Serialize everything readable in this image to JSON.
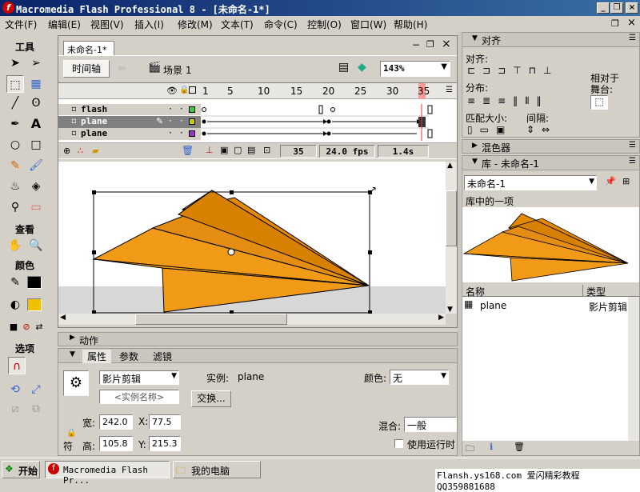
{
  "window": {
    "title": "Macromedia Flash Professional 8 - [未命名-1*]"
  },
  "menu": [
    "文件(F)",
    "编辑(E)",
    "视图(V)",
    "插入(I)",
    "修改(M)",
    "文本(T)",
    "命令(C)",
    "控制(O)",
    "窗口(W)",
    "帮助(H)"
  ],
  "toolbox": {
    "tools_label": "工具",
    "view_label": "查看",
    "colors_label": "颜色",
    "options_label": "选项"
  },
  "document": {
    "tab": "未命名-1*",
    "timeline_button": "时间轴",
    "scene": "场景 1",
    "zoom": "143%",
    "frame_numbers": [
      "1",
      "5",
      "10",
      "15",
      "20",
      "25",
      "30",
      "35"
    ],
    "layers": [
      {
        "name": "flash",
        "color": "#33cc33",
        "selected": false
      },
      {
        "name": "plane",
        "color": "#cccc00",
        "selected": true
      },
      {
        "name": "plane",
        "color": "#9933cc",
        "selected": false
      }
    ],
    "current_frame": "35",
    "fps": "24.0 fps",
    "time": "1.4s"
  },
  "actions_panel": {
    "title": "动作"
  },
  "properties_panel": {
    "tabs": [
      "属性",
      "参数",
      "滤镜"
    ],
    "symbol_type": "影片剪辑",
    "instance_label": "实例:",
    "instance_value": "plane",
    "instance_name_placeholder": "<实例名称>",
    "swap_button": "交换...",
    "color_label": "颜色:",
    "color_value": "无",
    "width_label": "宽:",
    "width_value": "242.0",
    "height_label": "高:",
    "height_value": "105.8",
    "x_label": "X:",
    "x_value": "77.5",
    "y_label": "Y:",
    "y_value": "215.3",
    "blend_label": "混合:",
    "blend_value": "一般",
    "runtime_cache_label": "使用运行时",
    "lock_label": "符"
  },
  "align_panel": {
    "title": "对齐",
    "align_label": "对齐:",
    "distribute_label": "分布:",
    "match_size_label": "匹配大小:",
    "spacing_label": "间隔:",
    "relative_label": "相对于",
    "stage_label": "舞台:"
  },
  "mixer_panel": {
    "title": "混色器"
  },
  "library_panel": {
    "title": "库 - 未命名-1",
    "doc_select": "未命名-1",
    "count_label": "库中的一项",
    "name_col": "名称",
    "type_col": "类型",
    "items": [
      {
        "name": "plane",
        "type": "影片剪辑"
      }
    ]
  },
  "taskbar": {
    "start": "开始",
    "tasks": [
      "Macromedia Flash Pr...",
      "我的电脑"
    ],
    "watermark": "Flansh.ys168.com 爱闪精彩教程 QQ359881688"
  }
}
